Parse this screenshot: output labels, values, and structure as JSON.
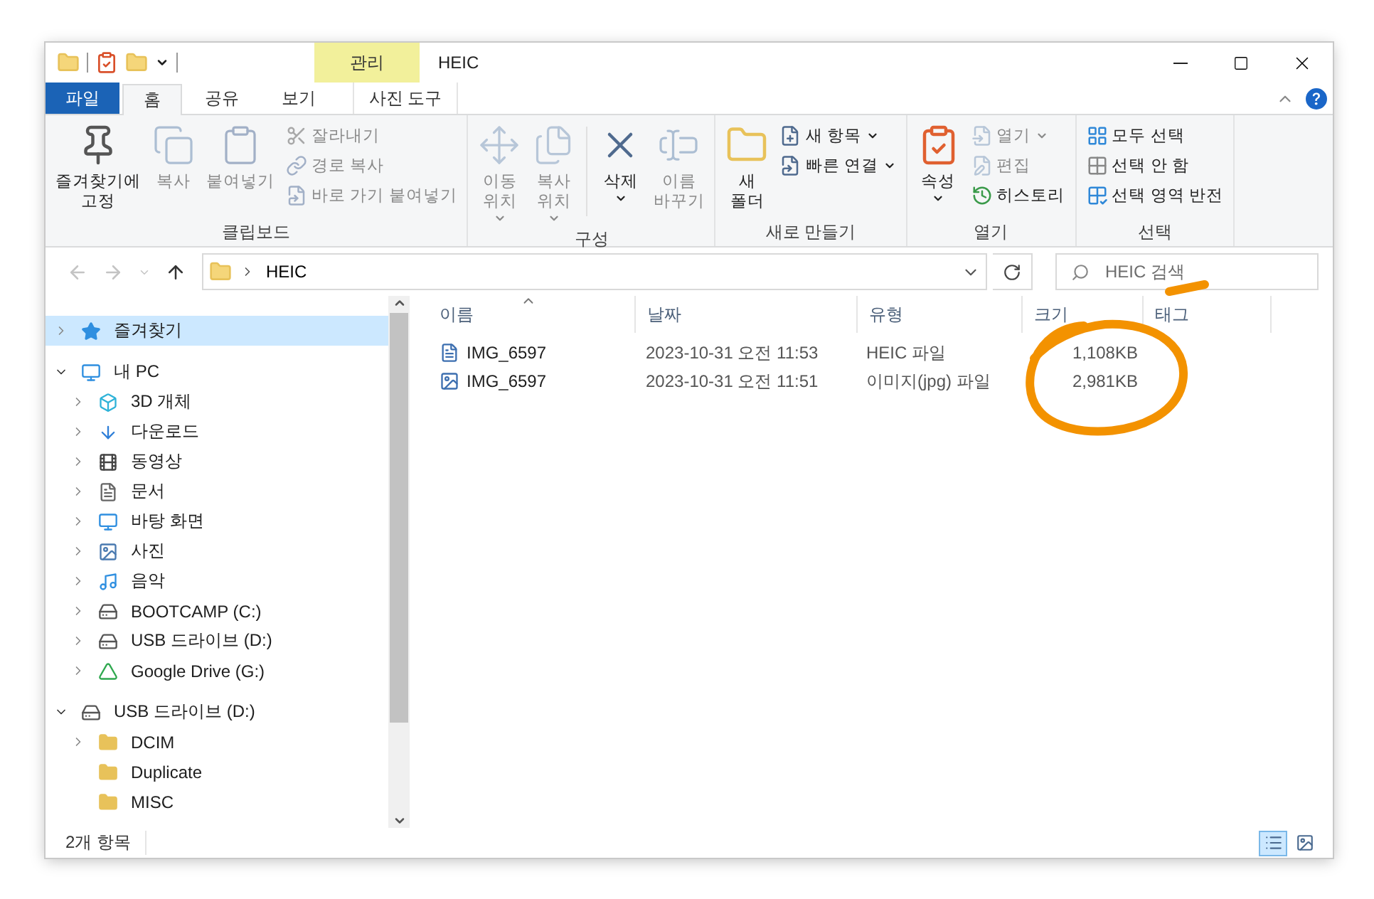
{
  "window": {
    "title": "HEIC",
    "context_group": "관리"
  },
  "tabs": [
    {
      "label": "파일",
      "kind": "file",
      "selected": false
    },
    {
      "label": "홈",
      "kind": "normal",
      "selected": true
    },
    {
      "label": "공유",
      "kind": "normal",
      "selected": false
    },
    {
      "label": "보기",
      "kind": "normal",
      "selected": false
    },
    {
      "label": "사진 도구",
      "kind": "context",
      "selected": false
    }
  ],
  "ribbon": {
    "groups": [
      {
        "label": "클립보드",
        "items": [
          {
            "kind": "large",
            "label": "즐겨찾기에\n고정",
            "disabled": false,
            "dropdown": false
          },
          {
            "kind": "large",
            "label": "복사",
            "disabled": true,
            "dropdown": false
          },
          {
            "kind": "large",
            "label": "붙여넣기",
            "disabled": true,
            "dropdown": false
          },
          {
            "kind": "small",
            "label": "잘라내기",
            "disabled": true,
            "dropdown": false
          },
          {
            "kind": "small",
            "label": "경로 복사",
            "disabled": true,
            "dropdown": false
          },
          {
            "kind": "small",
            "label": "바로 가기 붙여넣기",
            "disabled": true,
            "dropdown": false
          }
        ]
      },
      {
        "label": "구성",
        "items": [
          {
            "kind": "large",
            "label": "이동\n위치",
            "disabled": true,
            "dropdown": true
          },
          {
            "kind": "large",
            "label": "복사\n위치",
            "disabled": true,
            "dropdown": true
          },
          {
            "kind": "large",
            "label": "삭제",
            "disabled": false,
            "dropdown": true
          },
          {
            "kind": "large",
            "label": "이름\n바꾸기",
            "disabled": true,
            "dropdown": false
          }
        ]
      },
      {
        "label": "새로 만들기",
        "items": [
          {
            "kind": "large",
            "label": "새\n폴더",
            "disabled": false,
            "dropdown": false
          },
          {
            "kind": "small",
            "label": "새 항목",
            "disabled": false,
            "dropdown": true
          },
          {
            "kind": "small",
            "label": "빠른 연결",
            "disabled": false,
            "dropdown": true
          }
        ]
      },
      {
        "label": "열기",
        "items": [
          {
            "kind": "large",
            "label": "속성",
            "disabled": false,
            "dropdown": true
          },
          {
            "kind": "small",
            "label": "열기",
            "disabled": true,
            "dropdown": true
          },
          {
            "kind": "small",
            "label": "편집",
            "disabled": true,
            "dropdown": false
          },
          {
            "kind": "small",
            "label": "히스토리",
            "disabled": false,
            "dropdown": false
          }
        ]
      },
      {
        "label": "선택",
        "items": [
          {
            "kind": "small",
            "label": "모두 선택",
            "disabled": false,
            "dropdown": false
          },
          {
            "kind": "small",
            "label": "선택 안 함",
            "disabled": false,
            "dropdown": false
          },
          {
            "kind": "small",
            "label": "선택 영역 반전",
            "disabled": false,
            "dropdown": false
          }
        ]
      }
    ]
  },
  "navigation": {
    "buttons": [
      {
        "kind": "back",
        "disabled": true
      },
      {
        "kind": "forward",
        "disabled": true
      },
      {
        "kind": "recent",
        "disabled": true
      },
      {
        "kind": "up",
        "disabled": false
      }
    ],
    "address": [
      "HEIC"
    ],
    "search": {
      "placeholder": "HEIC 검색"
    }
  },
  "sidebar": {
    "sections": [
      {
        "label": "즐겨찾기",
        "kind": "star",
        "selected": true,
        "expanded": false,
        "has_children": true
      },
      {
        "label": "내 PC",
        "kind": "pc",
        "selected": false,
        "expanded": true,
        "children": [
          {
            "label": "3D 개체",
            "kind": "cube",
            "selected": false,
            "has_children": true
          },
          {
            "label": "다운로드",
            "kind": "download",
            "selected": false,
            "has_children": true
          },
          {
            "label": "동영상",
            "kind": "video",
            "selected": false,
            "has_children": true
          },
          {
            "label": "문서",
            "kind": "document",
            "selected": false,
            "has_children": true
          },
          {
            "label": "바탕 화면",
            "kind": "desktop",
            "selected": false,
            "has_children": true
          },
          {
            "label": "사진",
            "kind": "picture",
            "selected": false,
            "has_children": true
          },
          {
            "label": "음악",
            "kind": "music",
            "selected": false,
            "has_children": true
          },
          {
            "label": "BOOTCAMP (C:)",
            "kind": "windows-drive",
            "selected": false,
            "has_children": true
          },
          {
            "label": "USB 드라이브 (D:)",
            "kind": "drive",
            "selected": false,
            "has_children": true
          },
          {
            "label": "Google Drive (G:)",
            "kind": "gdrive",
            "selected": false,
            "has_children": true
          }
        ]
      },
      {
        "label": "USB 드라이브 (D:)",
        "kind": "drive",
        "selected": false,
        "expanded": true,
        "children": [
          {
            "label": "DCIM",
            "kind": "folder",
            "selected": false,
            "has_children": true
          },
          {
            "label": "Duplicate",
            "kind": "folder",
            "selected": false,
            "has_children": false
          },
          {
            "label": "MISC",
            "kind": "folder",
            "selected": false,
            "has_children": false
          }
        ]
      }
    ]
  },
  "file_list": {
    "columns": [
      {
        "label": "이름",
        "sorted": true
      },
      {
        "label": "날짜",
        "sorted": false
      },
      {
        "label": "유형",
        "sorted": false
      },
      {
        "label": "크기",
        "sorted": false
      },
      {
        "label": "태그",
        "sorted": false
      }
    ],
    "rows": [
      {
        "kind": "heic",
        "name": "IMG_6597",
        "date": "2023-10-31 오전 11:53",
        "type": "HEIC 파일",
        "size": "1,108KB",
        "selected": false
      },
      {
        "kind": "jpg",
        "name": "IMG_6597",
        "date": "2023-10-31 오전 11:51",
        "type": "이미지(jpg) 파일",
        "size": "2,981KB",
        "selected": false
      }
    ]
  },
  "status_bar": {
    "count": "2개 항목",
    "view_buttons": [
      {
        "kind": "details",
        "selected": true
      },
      {
        "kind": "large-icons",
        "selected": false
      }
    ]
  }
}
